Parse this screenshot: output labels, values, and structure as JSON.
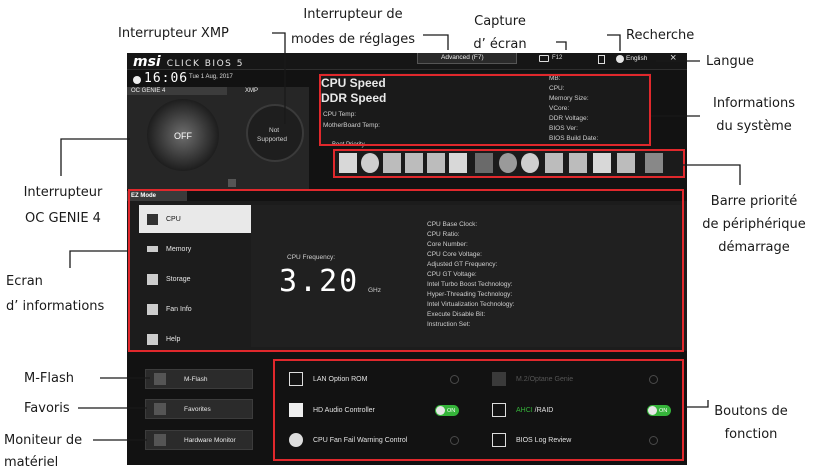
{
  "callouts": {
    "xmp_switch": "Interrupteur XMP",
    "mode_switch_1": "Interrupteur de",
    "mode_switch_2": "modes de réglages",
    "screenshot_1": "Capture",
    "screenshot_2": "d’ écran",
    "search": "Recherche",
    "language": "Langue",
    "sysinfo_1": "Informations",
    "sysinfo_2": "du système",
    "ocgenie_1": "Interrupteur",
    "ocgenie_2": "OC GENIE 4",
    "boot_1": "Barre priorité",
    "boot_2": "de périphérique",
    "boot_3": "démarrage",
    "info_screen_1": "Ecran",
    "info_screen_2": "d’ informations",
    "mflash": "M-Flash",
    "favorites": "Favoris",
    "hwmon_1": "Moniteur de",
    "hwmon_2": "matériel",
    "function_buttons_1": "Boutons de",
    "function_buttons_2": "fonction"
  },
  "bios": {
    "logo_brand": "msi",
    "logo_product": "CLICK BIOS 5",
    "mode_tab": "Advanced (F7)",
    "screenshot_key": "F12",
    "language": "English",
    "close": "×",
    "time": "16:06",
    "date": "Tue 1 Aug, 2017",
    "oc_genie_label": "OC GENIE 4",
    "xmp_label": "XMP",
    "oc_knob": "OFF",
    "xmp_knob_1": "Not",
    "xmp_knob_2": "Supported",
    "cpu_speed": "CPU Speed",
    "ddr_speed": "DDR Speed",
    "cpu_temp": "CPU Temp:",
    "mb_temp": "MotherBoard Temp:",
    "sysinfo_labels": [
      "MB:",
      "CPU:",
      "Memory Size:",
      "VCore:",
      "DDR Voltage:",
      "BIOS Ver:",
      "BIOS Build Date:"
    ],
    "boot_priority": "Boot Priority",
    "ez_mode": "EZ Mode",
    "menu": [
      "CPU",
      "Memory",
      "Storage",
      "Fan Info",
      "Help"
    ],
    "cpu_frequency_label": "CPU Frequency:",
    "cpu_frequency_value": "3.20",
    "cpu_frequency_unit": "GHz",
    "cpu_details": [
      "CPU Base Clock:",
      "CPU Ratio:",
      "Core Number:",
      "CPU Core Voltage:",
      "Adjusted GT Frequency:",
      "CPU GT Voltage:",
      "Intel Turbo Boost Technology:",
      "Hyper-Threading Technology:",
      "Intel Virtualization Technology:",
      "Execute Disable Bit:",
      "Instruction Set:"
    ],
    "left_buttons": [
      "M-Flash",
      "Favorites",
      "Hardware Monitor"
    ],
    "functions": {
      "lan": "LAN Option ROM",
      "m2": "M.2/Optane Genie",
      "audio": "HD Audio Controller",
      "ahci": "AHCI",
      "raid": "RAID",
      "cpu_fan": "CPU Fan Fail Warning Control",
      "bios_log": "BIOS Log Review",
      "on": "ON"
    }
  },
  "colors": {
    "highlight": "#e0282c",
    "toggle_on": "#35b43a",
    "screen_bg": "#121212"
  }
}
